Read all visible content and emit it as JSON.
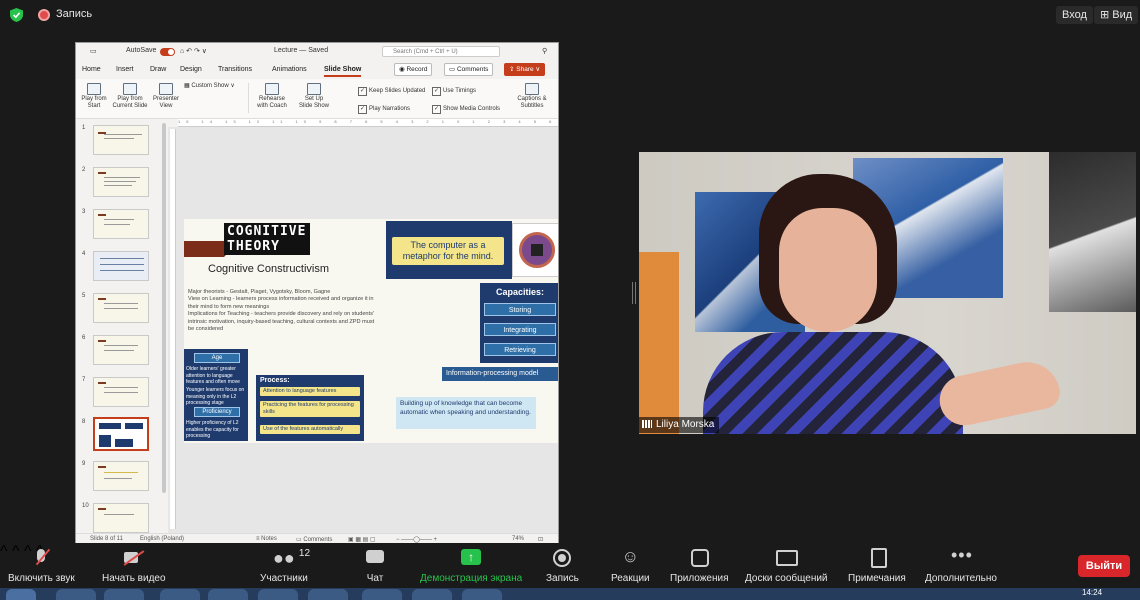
{
  "topbar": {
    "record_label": "Запись",
    "enter": "Вход",
    "view": "Вид"
  },
  "ppt": {
    "title": {
      "autosave": "AutoSave",
      "filename": "Lecture — Saved",
      "search_placeholder": "Search (Cmd + Ctrl + U)"
    },
    "tabs": [
      "Home",
      "Insert",
      "Draw",
      "Design",
      "Transitions",
      "Animations",
      "Slide Show"
    ],
    "record": "Record",
    "comments": "Comments",
    "share": "Share",
    "ribbon": {
      "play_start": "Play from Start",
      "play_current": "Play from Current Slide",
      "presenter": "Presenter View",
      "custom_show": "Custom Show",
      "rehearse": "Rehearse with Coach",
      "setup": "Set Up Slide Show",
      "keep_unlisted": "Keep Slides Updated",
      "use_timings": "Use Timings",
      "play_narrations": "Play Narrations",
      "show_media": "Show Media Controls",
      "captions": "Captions & Subtitles"
    },
    "ruler": "15 14 13 12 11 10 9 8 7 6 5 4 3 2 1 0 1 2 3 4 5 6 7 8 9 10 11 12 13 14 15 16 17 18 19",
    "thumb_numbers": [
      "1",
      "2",
      "3",
      "4",
      "5",
      "6",
      "7",
      "8",
      "9",
      "10"
    ],
    "slide": {
      "title": "COGNITIVE THEORY",
      "subtitle": "Cognitive Constructivism",
      "metaphor": "The computer as a metaphor for the mind.",
      "theory_lines": [
        "Major theorists - Gestalt, Piaget, Vygotsky, Bloom, Gagne",
        "View on Learning - learners process information received and organize it in",
        "their mind to form new meanings",
        "Implications for Teaching - teachers provide discovery and rely on students'",
        "intrinsic motivation, inquiry-based teaching, cultural contexts and ZPD must",
        "be considered"
      ],
      "capacities_title": "Capacities:",
      "capacities": [
        "Storing",
        "Integrating",
        "Retrieving"
      ],
      "info_model": "Information-processing model",
      "age_head": "Age",
      "age_text": "Older learners' greater attention to language features and often move",
      "age_text2": "Younger learners focus on meaning only in the L2 processing stage",
      "proficiency_head": "Proficiency",
      "proficiency_text": "Higher proficiency of L2 enables the capacity for processing",
      "process_title": "Process:",
      "process_items": [
        "Attention to language features",
        "Practicing the features for processing skills",
        "Use of the features automatically"
      ],
      "building": "Building up of knowledge that can become automatic when speaking and understanding."
    },
    "status": {
      "slide": "Slide 8 of 11",
      "lang": "English (Poland)",
      "notes": "Notes",
      "comments": "Comments",
      "zoom": "74%"
    }
  },
  "video": {
    "name": "Liliya Morska"
  },
  "toolbar": {
    "mute": "Включить звук",
    "video": "Начать видео",
    "participants": "Участники",
    "participants_count": "12",
    "chat": "Чат",
    "share": "Демонстрация экрана",
    "record": "Запись",
    "reactions": "Реакции",
    "apps": "Приложения",
    "boards": "Доски сообщений",
    "notes": "Примечания",
    "more": "Дополнительно",
    "leave": "Выйти"
  },
  "clock": "14:24"
}
